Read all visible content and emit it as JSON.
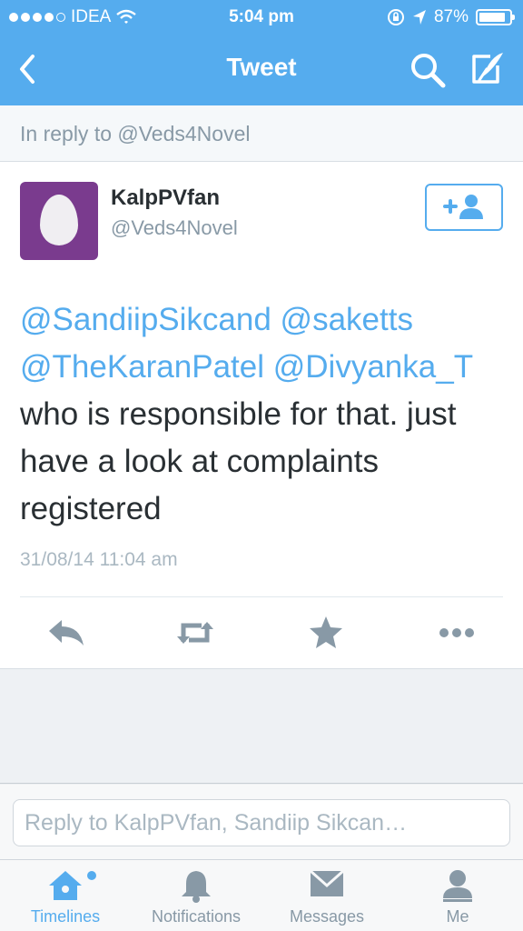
{
  "status_bar": {
    "carrier": "IDEA",
    "time": "5:04 pm",
    "battery_text": "87%",
    "battery_level": 0.87
  },
  "nav": {
    "title": "Tweet",
    "icons": [
      "back-chevron-icon",
      "search-icon",
      "compose-icon"
    ]
  },
  "reply_context": "In reply to @Veds4Novel",
  "tweet": {
    "name": "KalpPVfan",
    "handle": "@Veds4Novel",
    "mentions": [
      "@SandiipSikcand",
      "@saketts",
      "@TheKaranPatel",
      "@Divyanka_T"
    ],
    "text": "who is responsible for that. just have a look at complaints registered",
    "timestamp": "31/08/14 11:04 am",
    "actions": [
      "reply-icon",
      "retweet-icon",
      "favorite-icon",
      "more-icon"
    ]
  },
  "reply_bar": {
    "placeholder": "Reply to KalpPVfan, Sandiip Sikcan…"
  },
  "tabs": [
    {
      "label": "Timelines",
      "icon": "home-icon",
      "active": true,
      "unread": true
    },
    {
      "label": "Notifications",
      "icon": "bell-icon",
      "active": false
    },
    {
      "label": "Messages",
      "icon": "envelope-icon",
      "active": false
    },
    {
      "label": "Me",
      "icon": "person-icon",
      "active": false
    }
  ],
  "colors": {
    "brand": "#55acee",
    "text": "#292f33",
    "muted": "#8899a6",
    "avatar_bg": "#7a3b8e"
  }
}
